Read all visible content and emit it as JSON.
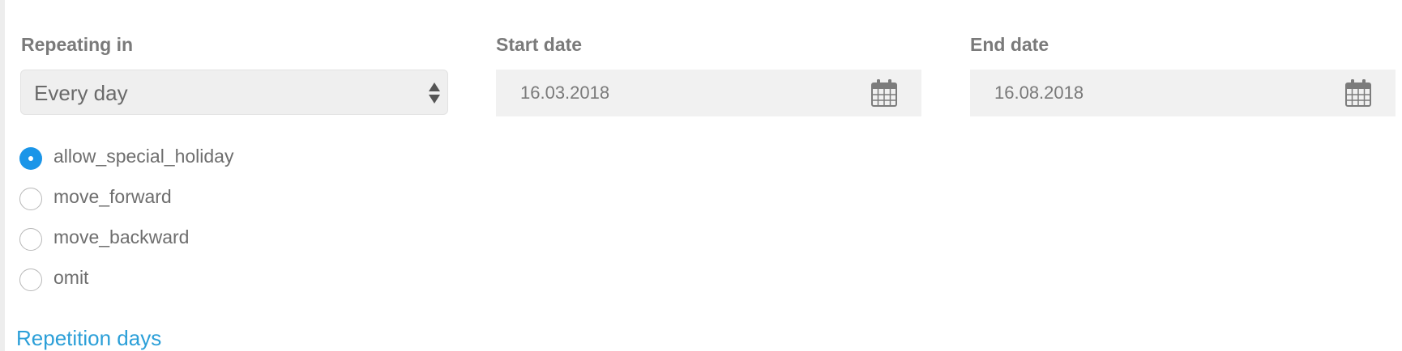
{
  "repeating": {
    "label": "Repeating in",
    "value": "Every day"
  },
  "start_date": {
    "label": "Start date",
    "value": "16.03.2018"
  },
  "end_date": {
    "label": "End date",
    "value": "16.08.2018"
  },
  "holiday_options": {
    "selected": "allow_special_holiday",
    "items": [
      {
        "label": "allow_special_holiday",
        "checked": true
      },
      {
        "label": "move_forward",
        "checked": false
      },
      {
        "label": "move_backward",
        "checked": false
      },
      {
        "label": "omit",
        "checked": false
      }
    ]
  },
  "section": {
    "title": "Repetition days"
  },
  "colors": {
    "accent": "#1a95e8",
    "link": "#2b9fd8",
    "label": "#7a7a7a",
    "field_bg": "#f1f1f1"
  },
  "icons": {
    "select": "up-down-arrows-icon",
    "date": "calendar-icon"
  }
}
